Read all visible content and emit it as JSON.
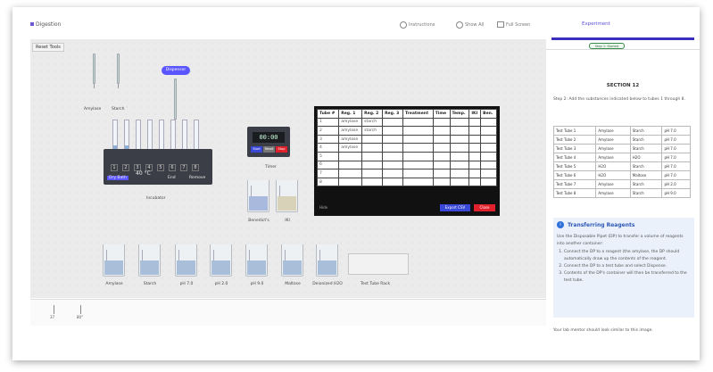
{
  "app": {
    "title": "Digestion"
  },
  "top_controls": [
    {
      "label": "Instructions"
    },
    {
      "label": "Show All"
    },
    {
      "label": "Full Screen"
    }
  ],
  "canvas": {
    "reset_label": "Reset Tools",
    "pipettes": [
      {
        "label": "Amylase"
      },
      {
        "label": "Starch"
      }
    ],
    "dispenser_label": "Dispenser",
    "incubator": {
      "label": "Incubator",
      "slots": [
        "1",
        "2",
        "3",
        "4",
        "5",
        "6",
        "7",
        "8"
      ],
      "controls": [
        "Dry Bath",
        "40 °C",
        "End",
        "Remove"
      ]
    },
    "timer": {
      "display": "00:00",
      "buttons": [
        "Start",
        "Reset",
        "Stop"
      ],
      "label": "Timer"
    },
    "results_table": {
      "headers": [
        "Tube #",
        "Reg. 1",
        "Reg. 2",
        "Reg. 3",
        "Treatment",
        "Time",
        "Temp.",
        "IKI",
        "Ben."
      ],
      "rows": [
        [
          "1",
          "amylase",
          "starch",
          "",
          "",
          "",
          "",
          "",
          ""
        ],
        [
          "2",
          "amylase",
          "starch",
          "",
          "",
          "",
          "",
          "",
          ""
        ],
        [
          "3",
          "amylase",
          "",
          "",
          "",
          "",
          "",
          "",
          ""
        ],
        [
          "4",
          "amylase",
          "",
          "",
          "",
          "",
          "",
          "",
          ""
        ],
        [
          "5",
          "",
          "",
          "",
          "",
          "",
          "",
          "",
          ""
        ],
        [
          "6",
          "",
          "",
          "",
          "",
          "",
          "",
          "",
          ""
        ],
        [
          "7",
          "",
          "",
          "",
          "",
          "",
          "",
          "",
          ""
        ],
        [
          "8",
          "",
          "",
          "",
          "",
          "",
          "",
          "",
          ""
        ]
      ],
      "footer_text": "Hide",
      "export_label": "Export CSV",
      "close_label": "Close"
    },
    "beakers_top": [
      {
        "label": "Benedict's"
      },
      {
        "label": "IKI"
      }
    ],
    "beakers_bottom": [
      {
        "label": "Amylase"
      },
      {
        "label": "Starch"
      },
      {
        "label": "pH 7.0"
      },
      {
        "label": "pH 2.0"
      },
      {
        "label": "pH 9.0"
      },
      {
        "label": "Maltose"
      },
      {
        "label": "Deionized H2O"
      }
    ],
    "rack_label": "Test Tube Rack"
  },
  "bottom_bar": {
    "items": [
      {
        "label": "37"
      },
      {
        "label": "80°"
      }
    ]
  },
  "sidebar": {
    "tab_label": "Experiment",
    "step_pill": "Step 1: Started",
    "section_title": "SECTION 12",
    "step_text": "Step 2: Add the substances indicated below to tubes 1 through 8.",
    "tube_table": [
      [
        "Test Tube 1",
        "Amylase",
        "Starch",
        "pH 7.0"
      ],
      [
        "Test Tube 2",
        "Amylase",
        "Starch",
        "pH 7.0"
      ],
      [
        "Test Tube 3",
        "Amylase",
        "Starch",
        "pH 7.0"
      ],
      [
        "Test Tube 4",
        "Amylase",
        "H2O",
        "pH 7.0"
      ],
      [
        "Test Tube 5",
        "H2O",
        "Starch",
        "pH 7.0"
      ],
      [
        "Test Tube 6",
        "H2O",
        "Maltose",
        "pH 7.0"
      ],
      [
        "Test Tube 7",
        "Amylase",
        "Starch",
        "pH 2.0"
      ],
      [
        "Test Tube 8",
        "Amylase",
        "Starch",
        "pH 9.0"
      ]
    ],
    "info": {
      "title": "Transferring Reagents",
      "intro": "Use the Disposable Pipet (DP) to transfer a volume of reagents into another container:",
      "steps": [
        "Connect the DP to a reagent (the amylase, the DP should automatically draw up the contents of the reagent.",
        "Connect the DP to a test tube and select Dispense.",
        "Contents of the DP's container will then be transferred to the test tube."
      ]
    },
    "footer": "Your lab mentor should look similar to this image."
  },
  "colors": {
    "accent": "#5a55ff",
    "device": "#3c3e47",
    "close_red": "#e0202a",
    "export_blue": "#3a48d8",
    "info_bg": "#eaf1fb"
  }
}
